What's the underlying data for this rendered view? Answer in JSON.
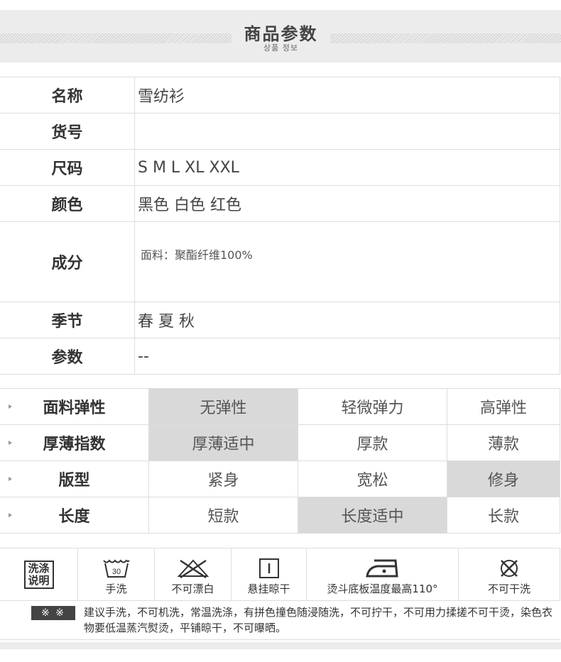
{
  "header": {
    "title": "商品参数",
    "subtitle": "상품 정보"
  },
  "params": [
    {
      "label": "名称",
      "value": "雪纺衫"
    },
    {
      "label": "货号",
      "value": ""
    },
    {
      "label": "尺码",
      "value": "S M L XL XXL"
    },
    {
      "label": "颜色",
      "value": "黑色 白色 红色"
    },
    {
      "label": "成分",
      "value": "面料：聚酯纤维100%"
    },
    {
      "label": "季节",
      "value": "春 夏 秋"
    },
    {
      "label": "参数",
      "value": "--"
    }
  ],
  "attributes": [
    {
      "label": "面料弹性",
      "options": [
        "无弹性",
        "轻微弹力",
        "高弹性"
      ],
      "selected_index": 0
    },
    {
      "label": "厚薄指数",
      "options": [
        "厚薄适中",
        "厚款",
        "薄款"
      ],
      "selected_index": 0
    },
    {
      "label": "版型",
      "options": [
        "紧身",
        "宽松",
        "修身"
      ],
      "selected_index": 2
    },
    {
      "label": "长度",
      "options": [
        "短款",
        "长度适中",
        "长款"
      ],
      "selected_index": 1
    }
  ],
  "care": {
    "badge": "洗涤说明",
    "items": [
      {
        "icon": "hand-wash-30-icon",
        "label": "手洗",
        "icon_text": "30"
      },
      {
        "icon": "no-bleach-icon",
        "label": "不可漂白"
      },
      {
        "icon": "hang-dry-icon",
        "label": "悬挂晾干"
      },
      {
        "icon": "iron-icon",
        "label": "烫斗底板温度最高110°"
      },
      {
        "icon": "no-dry-clean-icon",
        "label": "不可干洗"
      }
    ],
    "note_mark": "※ ※",
    "note": "建议手洗，不可机洗，常温洗涤，有拼色撞色随浸随洗，不可拧干，不可用力揉搓不可干烫，染色衣物要低温蒸汽熨烫，平铺晾干，不可曝晒。"
  },
  "colors": {
    "selected_bg": "#d9d9d9",
    "border": "#dddddd",
    "banner_bg": "#ececec"
  }
}
